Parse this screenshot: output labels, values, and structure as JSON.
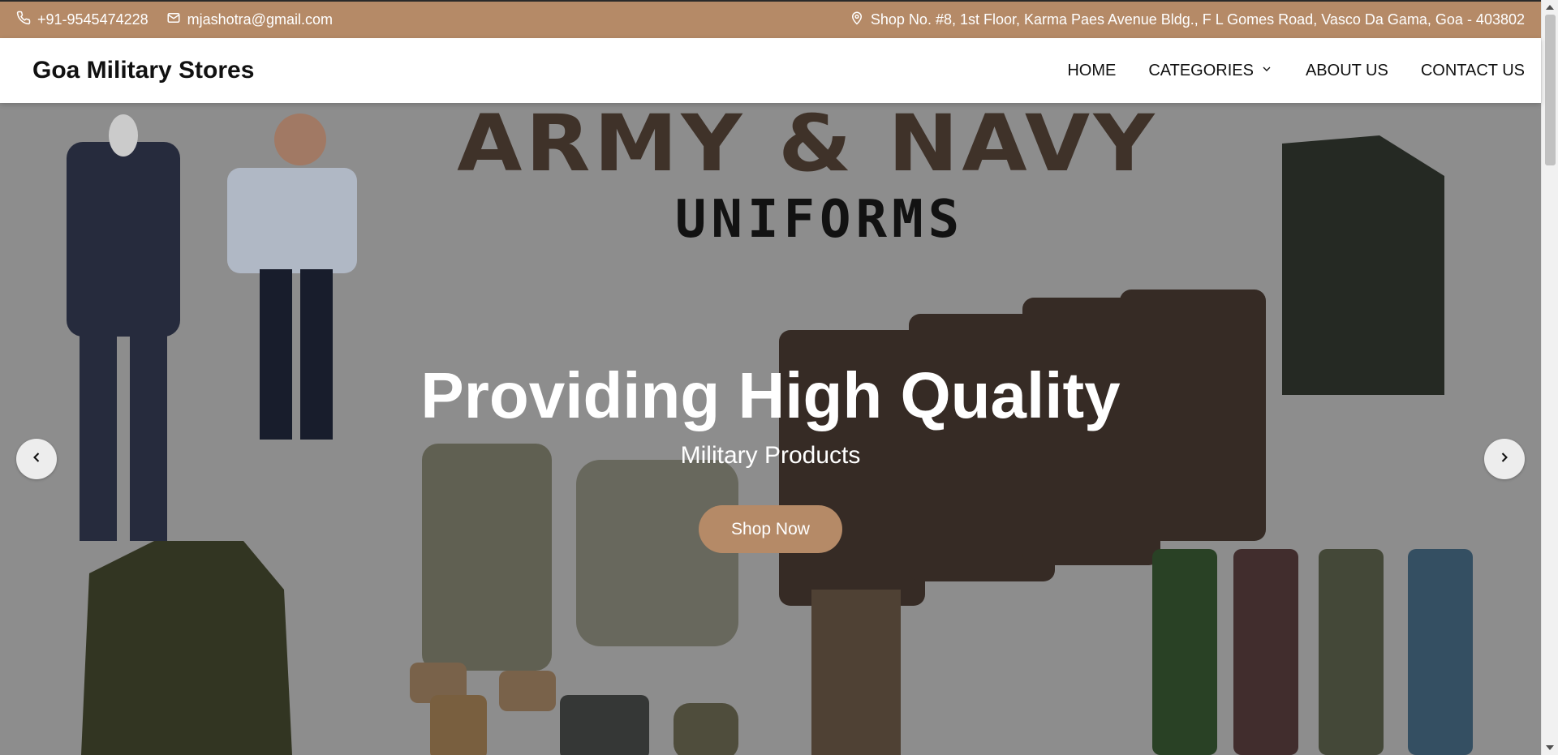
{
  "topbar": {
    "phone": "+91-9545474228",
    "email": "mjashotra@gmail.com",
    "address": "Shop No. #8, 1st Floor, Karma Paes Avenue Bldg., F L Gomes Road, Vasco Da Gama, Goa - 403802"
  },
  "header": {
    "brand": "Goa Military Stores",
    "nav": {
      "home": "HOME",
      "categories": "CATEGORIES",
      "about": "ABOUT US",
      "contact": "CONTACT US"
    }
  },
  "hero": {
    "banner_line1": "ARMY & NAVY",
    "banner_line2": "UNIFORMS",
    "title": "Providing High Quality",
    "subtitle": "Military Products",
    "cta": "Shop Now"
  },
  "colors": {
    "accent": "#b58a67",
    "topbar_text": "#ffffff",
    "hero_overlay": "#9a9a9a"
  },
  "icons": {
    "phone": "phone-icon",
    "email": "mail-icon",
    "address": "map-pin-icon",
    "dropdown": "chevron-down-icon",
    "prev": "chevron-left-icon",
    "next": "chevron-right-icon"
  }
}
